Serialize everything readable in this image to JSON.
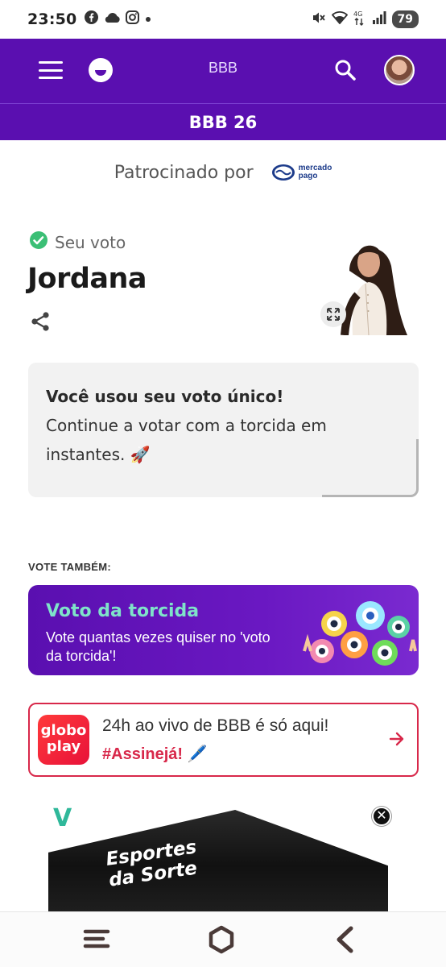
{
  "status_bar": {
    "time": "23:50",
    "left_icons": [
      "facebook-icon",
      "cloud-icon",
      "instagram-icon",
      "dot-icon"
    ],
    "right_icons": [
      "mute-icon",
      "wifi-icon",
      "network-4g-icon",
      "signal-icon"
    ],
    "battery": "79"
  },
  "header": {
    "title": "BBB",
    "section": "BBB 26",
    "color": "#5a0fb0"
  },
  "sponsor": {
    "label": "Patrocinado por",
    "brand_line1": "mercado",
    "brand_line2": "pago"
  },
  "vote": {
    "status_label": "Seu voto",
    "candidate": "Jordana"
  },
  "message": {
    "title": "Você usou seu voto único!",
    "body": "Continue a votar com a torcida em instantes. 🚀"
  },
  "vote_also": {
    "heading": "VOTE TAMBÉM:",
    "card_title": "Voto da torcida",
    "card_text": "Vote quantas vezes quiser no 'voto da torcida'!"
  },
  "globoplay": {
    "logo_line1": "globo",
    "logo_line2": "play",
    "headline": "24h ao vivo de BBB é só aqui!",
    "cta": "#Assinejá! 🖊️"
  },
  "ad": {
    "badge": "V",
    "text_line1": "Esportes",
    "text_line2": "da Sorte",
    "close_symbol": "✕"
  },
  "nav": {
    "icons": [
      "recents-icon",
      "home-icon",
      "back-icon"
    ]
  }
}
